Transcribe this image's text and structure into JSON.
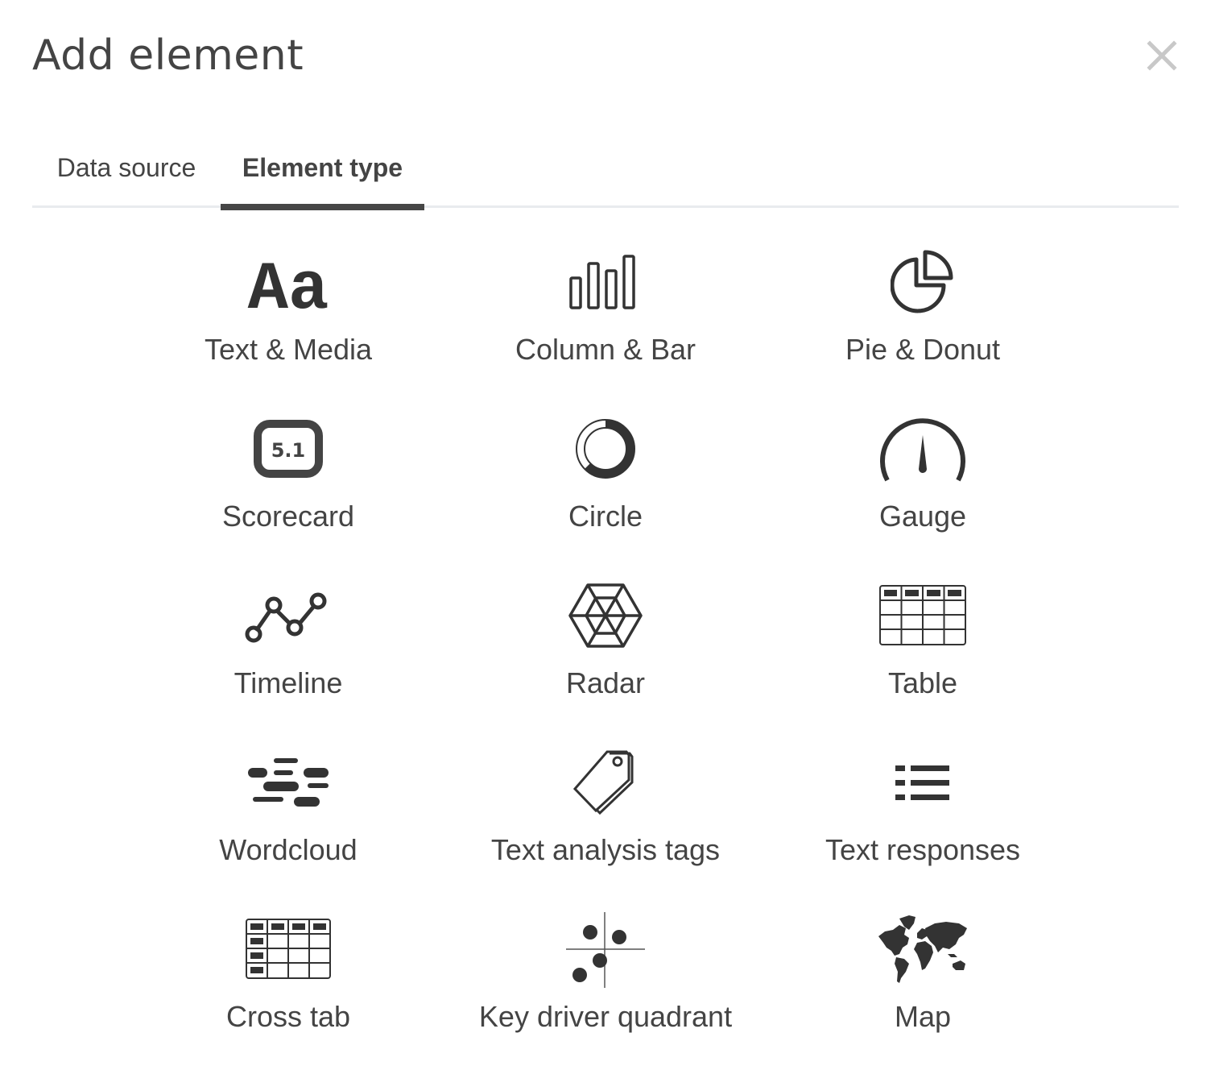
{
  "dialog": {
    "title": "Add element",
    "close_icon": "close-icon"
  },
  "tabs": [
    {
      "label": "Data source",
      "active": false
    },
    {
      "label": "Element type",
      "active": true
    }
  ],
  "colors": {
    "text": "#444444",
    "icon": "#333333",
    "active_tab_underline": "#464646",
    "tab_divider": "#e9ebee",
    "close_icon": "#c8c8c8"
  },
  "element_types": [
    {
      "label": "Text & Media",
      "icon": "text-media-icon"
    },
    {
      "label": "Column & Bar",
      "icon": "column-bar-icon"
    },
    {
      "label": "Pie & Donut",
      "icon": "pie-donut-icon"
    },
    {
      "label": "Scorecard",
      "icon": "scorecard-icon",
      "icon_text": "5.1"
    },
    {
      "label": "Circle",
      "icon": "circle-icon"
    },
    {
      "label": "Gauge",
      "icon": "gauge-icon"
    },
    {
      "label": "Timeline",
      "icon": "timeline-icon"
    },
    {
      "label": "Radar",
      "icon": "radar-icon"
    },
    {
      "label": "Table",
      "icon": "table-icon"
    },
    {
      "label": "Wordcloud",
      "icon": "wordcloud-icon"
    },
    {
      "label": "Text analysis tags",
      "icon": "tag-icon"
    },
    {
      "label": "Text responses",
      "icon": "list-icon"
    },
    {
      "label": "Cross tab",
      "icon": "cross-tab-icon"
    },
    {
      "label": "Key driver quadrant",
      "icon": "quadrant-icon"
    },
    {
      "label": "Map",
      "icon": "world-map-icon"
    }
  ],
  "icon_glyphs": {
    "text_media": "Aa"
  }
}
